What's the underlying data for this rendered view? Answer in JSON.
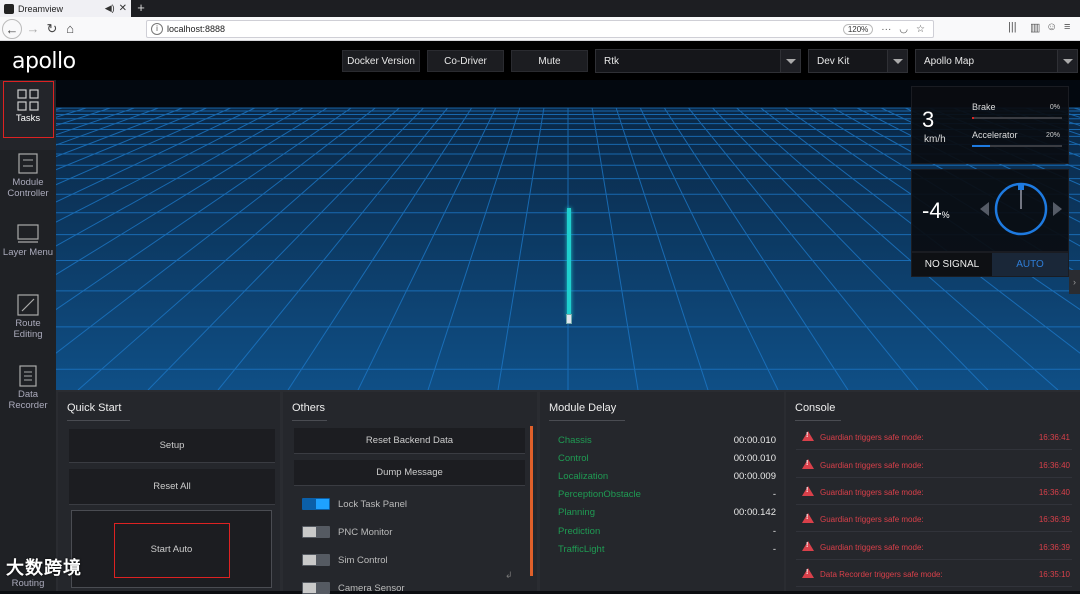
{
  "browser": {
    "tab_title": "Dreamview",
    "url": "localhost:8888",
    "zoom": "120%"
  },
  "header": {
    "logo": "apollo",
    "buttons": [
      "Docker Version",
      "Co-Driver",
      "Mute"
    ],
    "mode_select": "Rtk",
    "vehicle_select": "Dev Kit",
    "map_select": "Apollo Map"
  },
  "sidenav": {
    "items": [
      {
        "label": "Tasks",
        "icon": "grid-icon",
        "active": true
      },
      {
        "label": "Module Controller",
        "icon": "module-controller-icon"
      },
      {
        "label": "Layer Menu",
        "icon": "layer-menu-icon"
      },
      {
        "label": "Route Editing",
        "icon": "route-editing-icon"
      },
      {
        "label": "Data Recorder",
        "icon": "data-recorder-icon"
      }
    ],
    "partial_label": "Routing"
  },
  "dashboard": {
    "speed": "3",
    "speed_unit": "km/h",
    "brake_label": "Brake",
    "brake_value": "0%",
    "brake_level": 0.02,
    "accel_label": "Accelerator",
    "accel_value": "20%",
    "accel_level": 0.2,
    "steering": "-4",
    "steering_unit": "%",
    "signal": "NO SIGNAL",
    "drive_mode": "AUTO"
  },
  "quick_start": {
    "title": "Quick Start",
    "buttons": [
      "Setup",
      "Reset All",
      "Start Auto"
    ]
  },
  "others": {
    "title": "Others",
    "buttons": [
      "Reset Backend Data",
      "Dump Message"
    ],
    "toggles": [
      {
        "label": "Lock Task Panel",
        "on": true
      },
      {
        "label": "PNC Monitor",
        "on": false
      },
      {
        "label": "Sim Control",
        "on": false
      },
      {
        "label": "Camera Sensor",
        "on": false
      }
    ]
  },
  "module_delay": {
    "title": "Module Delay",
    "rows": [
      {
        "name": "Chassis",
        "value": "00:00.010"
      },
      {
        "name": "Control",
        "value": "00:00.010"
      },
      {
        "name": "Localization",
        "value": "00:00.009"
      },
      {
        "name": "PerceptionObstacle",
        "value": "-"
      },
      {
        "name": "Planning",
        "value": "00:00.142"
      },
      {
        "name": "Prediction",
        "value": "-"
      },
      {
        "name": "TrafficLight",
        "value": "-"
      }
    ]
  },
  "console": {
    "title": "Console",
    "rows": [
      {
        "msg": "Guardian triggers safe mode:",
        "time": "16:36:41"
      },
      {
        "msg": "Guardian triggers safe mode:",
        "time": "16:36:40"
      },
      {
        "msg": "Guardian triggers safe mode:",
        "time": "16:36:40"
      },
      {
        "msg": "Guardian triggers safe mode:",
        "time": "16:36:39"
      },
      {
        "msg": "Guardian triggers safe mode:",
        "time": "16:36:39"
      },
      {
        "msg": "Data Recorder triggers safe mode:",
        "time": "16:35:10"
      }
    ]
  },
  "watermark": "大数跨境",
  "colors": {
    "accent": "#1ea1ff",
    "module_ok": "#1f9b53",
    "console_error": "#d9404a",
    "active_highlight": "#dd2222"
  }
}
